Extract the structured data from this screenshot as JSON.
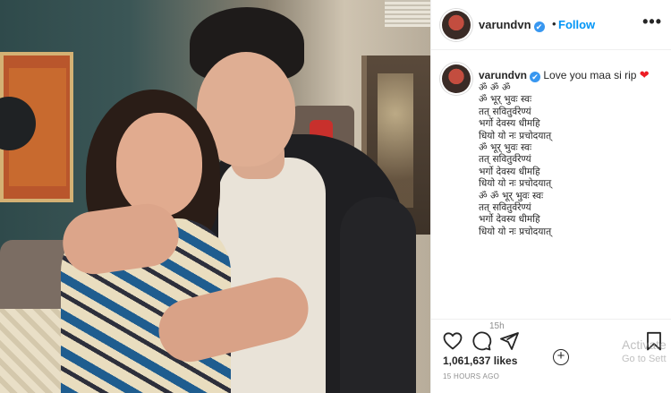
{
  "post": {
    "username": "varundvn",
    "verified_mark": "✔",
    "separator": "•",
    "follow_label": "Follow",
    "more_label": "•••"
  },
  "caption": {
    "username": "varundvn",
    "text": "Love you maa si rip",
    "heart": "❤",
    "mantra": "ॐ ॐ ॐ\nॐ भूर् भुवः स्वः\nतत् सवितुर्वरेण्यं\nभर्गो देवस्य धीमहि\nधियो यो नः प्रचोदयात्\nॐ भूर् भुवः स्वः\nतत् सवितुर्वरेण्यं\nभर्गो देवस्य धीमहि\nधियो यो नः प्रचोदयात्\nॐ ॐ भूर् भुवः स्वः\nतत् सवितुर्वरेण्यं\nभर्गो देवस्य धीमहि\nधियो यो नः प्रचोदयात्",
    "time": "15h",
    "expand_label": "+"
  },
  "actions": {
    "icons": [
      "heart-icon",
      "comment-icon",
      "share-icon",
      "bookmark-icon"
    ],
    "likes": "1,061,637 likes",
    "time_ago": "15 HOURS AGO"
  },
  "watermark": {
    "line1": "Activate",
    "line2": "Go to Sett"
  },
  "colors": {
    "link": "#0095f6",
    "verified": "#3897f0",
    "heart": "#ed1c24",
    "muted": "#8e8e8e",
    "text": "#262626"
  }
}
